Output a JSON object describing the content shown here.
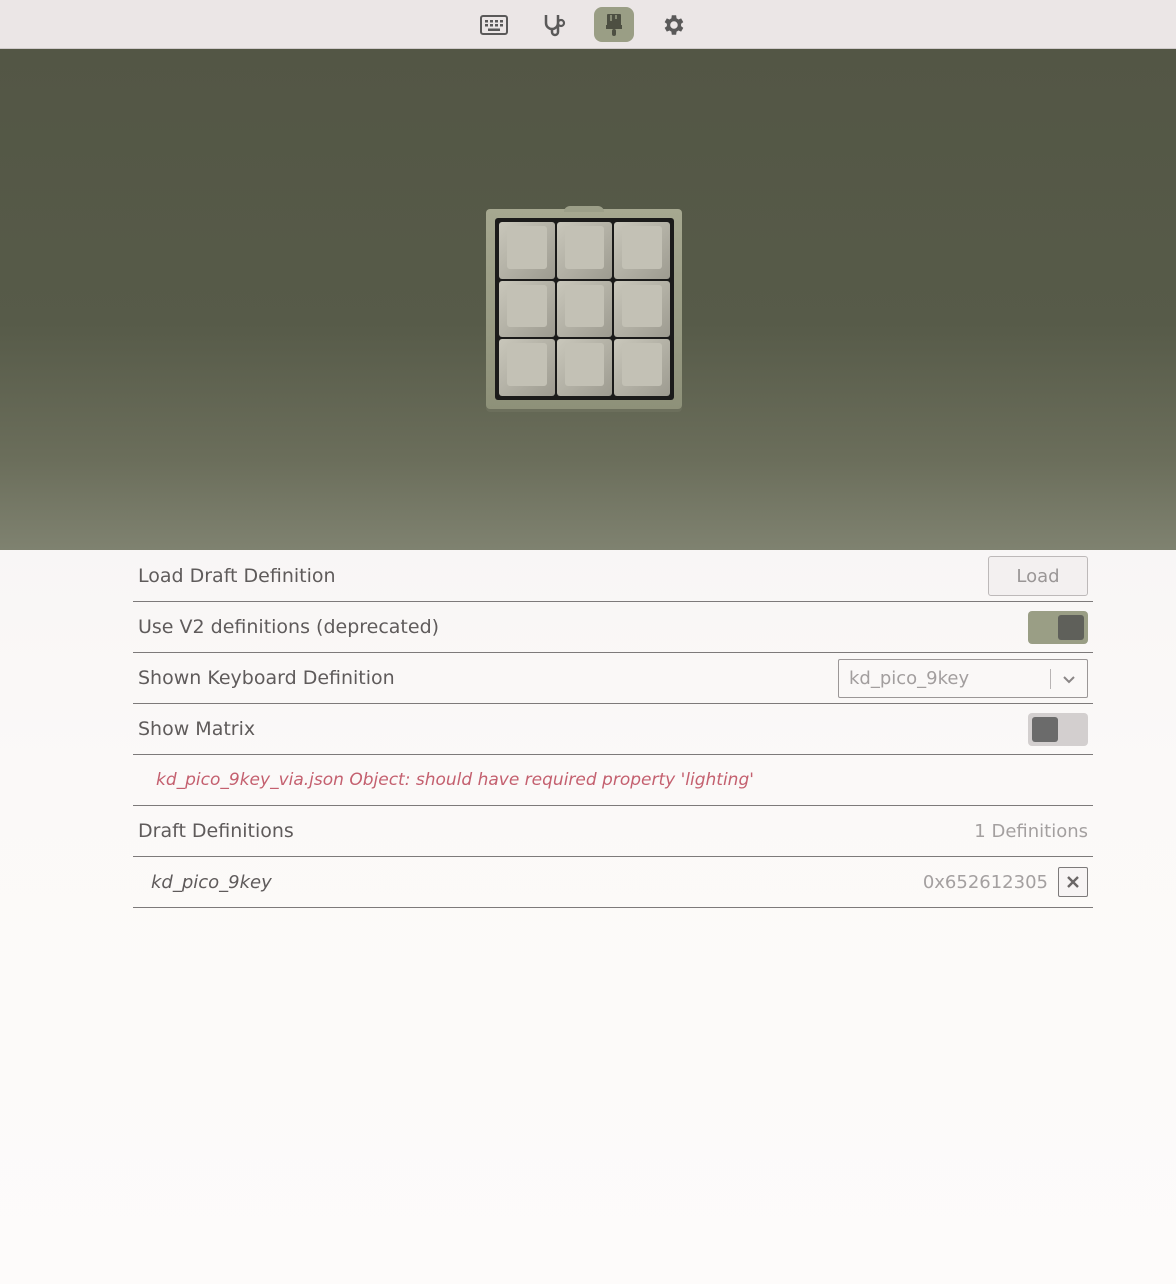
{
  "nav": {
    "items": [
      {
        "name": "keyboard-icon",
        "active": false
      },
      {
        "name": "stethoscope-icon",
        "active": false
      },
      {
        "name": "brush-icon",
        "active": true
      },
      {
        "name": "gear-icon",
        "active": false
      }
    ]
  },
  "preview": {
    "keys": 9,
    "case_color": "#9a9e85",
    "key_color": "#c3c1b5"
  },
  "settings": {
    "load_draft": {
      "label": "Load Draft Definition",
      "button": "Load"
    },
    "use_v2": {
      "label": "Use V2 definitions (deprecated)",
      "enabled": true
    },
    "shown_definition": {
      "label": "Shown Keyboard Definition",
      "value": "kd_pico_9key"
    },
    "show_matrix": {
      "label": "Show Matrix",
      "enabled": false
    },
    "error": "kd_pico_9key_via.json Object: should have required property 'lighting'",
    "draft_definitions": {
      "label": "Draft Definitions",
      "count": "1 Definitions"
    },
    "drafts": [
      {
        "name": "kd_pico_9key",
        "id": "0x652612305"
      }
    ]
  },
  "colors": {
    "accent": "#9a9e85",
    "error": "#c4606f",
    "stage": "#555847"
  }
}
